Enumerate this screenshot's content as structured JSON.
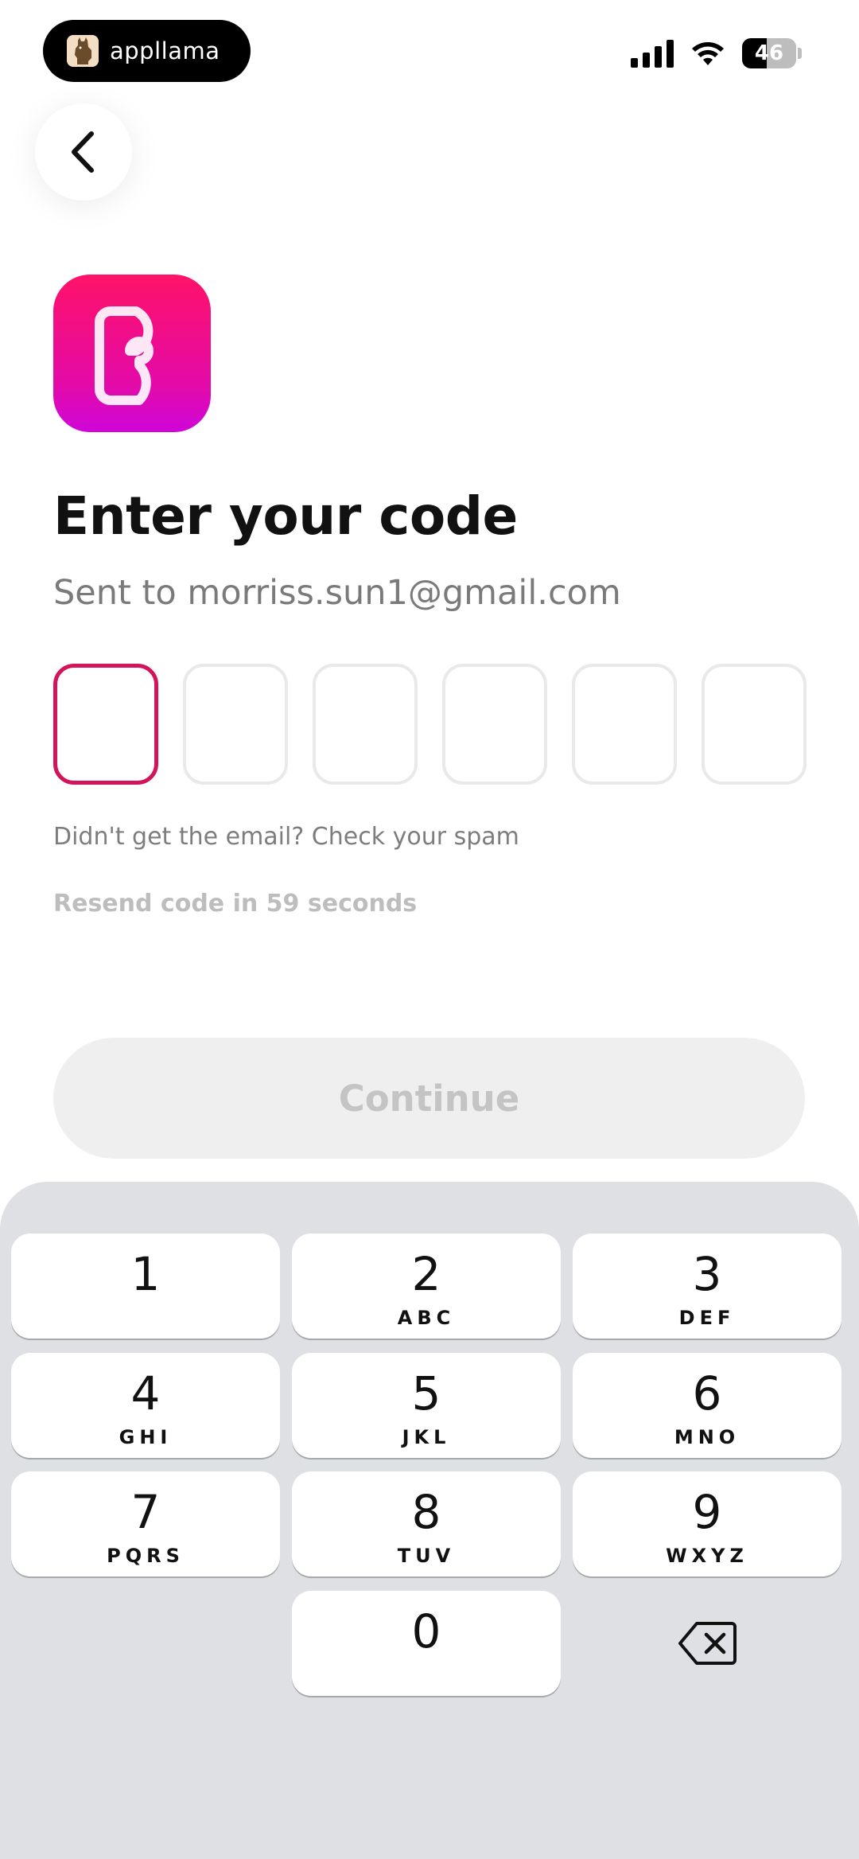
{
  "status_bar": {
    "brand_name": "appllama",
    "battery_level": "46",
    "battery_fraction": 0.46,
    "signal_bars": 4
  },
  "header": {
    "back_icon": "chevron-left-icon"
  },
  "app_icon": {
    "name": "b-logo-icon",
    "accent": "#ff1268"
  },
  "content": {
    "title": "Enter your code",
    "subtitle": "Sent to morriss.sun1@gmail.com",
    "code_length": 6,
    "code_values": [
      "",
      "",
      "",
      "",
      "",
      ""
    ],
    "spam_hint": "Didn't get the email? Check your spam",
    "resend_text": "Resend code in 59 seconds"
  },
  "actions": {
    "continue_label": "Continue"
  },
  "keypad": {
    "keys": [
      {
        "digit": "1",
        "letters": ""
      },
      {
        "digit": "2",
        "letters": "ABC"
      },
      {
        "digit": "3",
        "letters": "DEF"
      },
      {
        "digit": "4",
        "letters": "GHI"
      },
      {
        "digit": "5",
        "letters": "JKL"
      },
      {
        "digit": "6",
        "letters": "MNO"
      },
      {
        "digit": "7",
        "letters": "PQRS"
      },
      {
        "digit": "8",
        "letters": "TUV"
      },
      {
        "digit": "9",
        "letters": "WXYZ"
      },
      {
        "digit": "0",
        "letters": ""
      }
    ],
    "delete_icon": "backspace-icon"
  },
  "colors": {
    "active_border": "#d4145a",
    "inactive_border": "#e9e9e9",
    "button_disabled_bg": "#efefef",
    "keypad_bg": "#dfe0e4"
  }
}
